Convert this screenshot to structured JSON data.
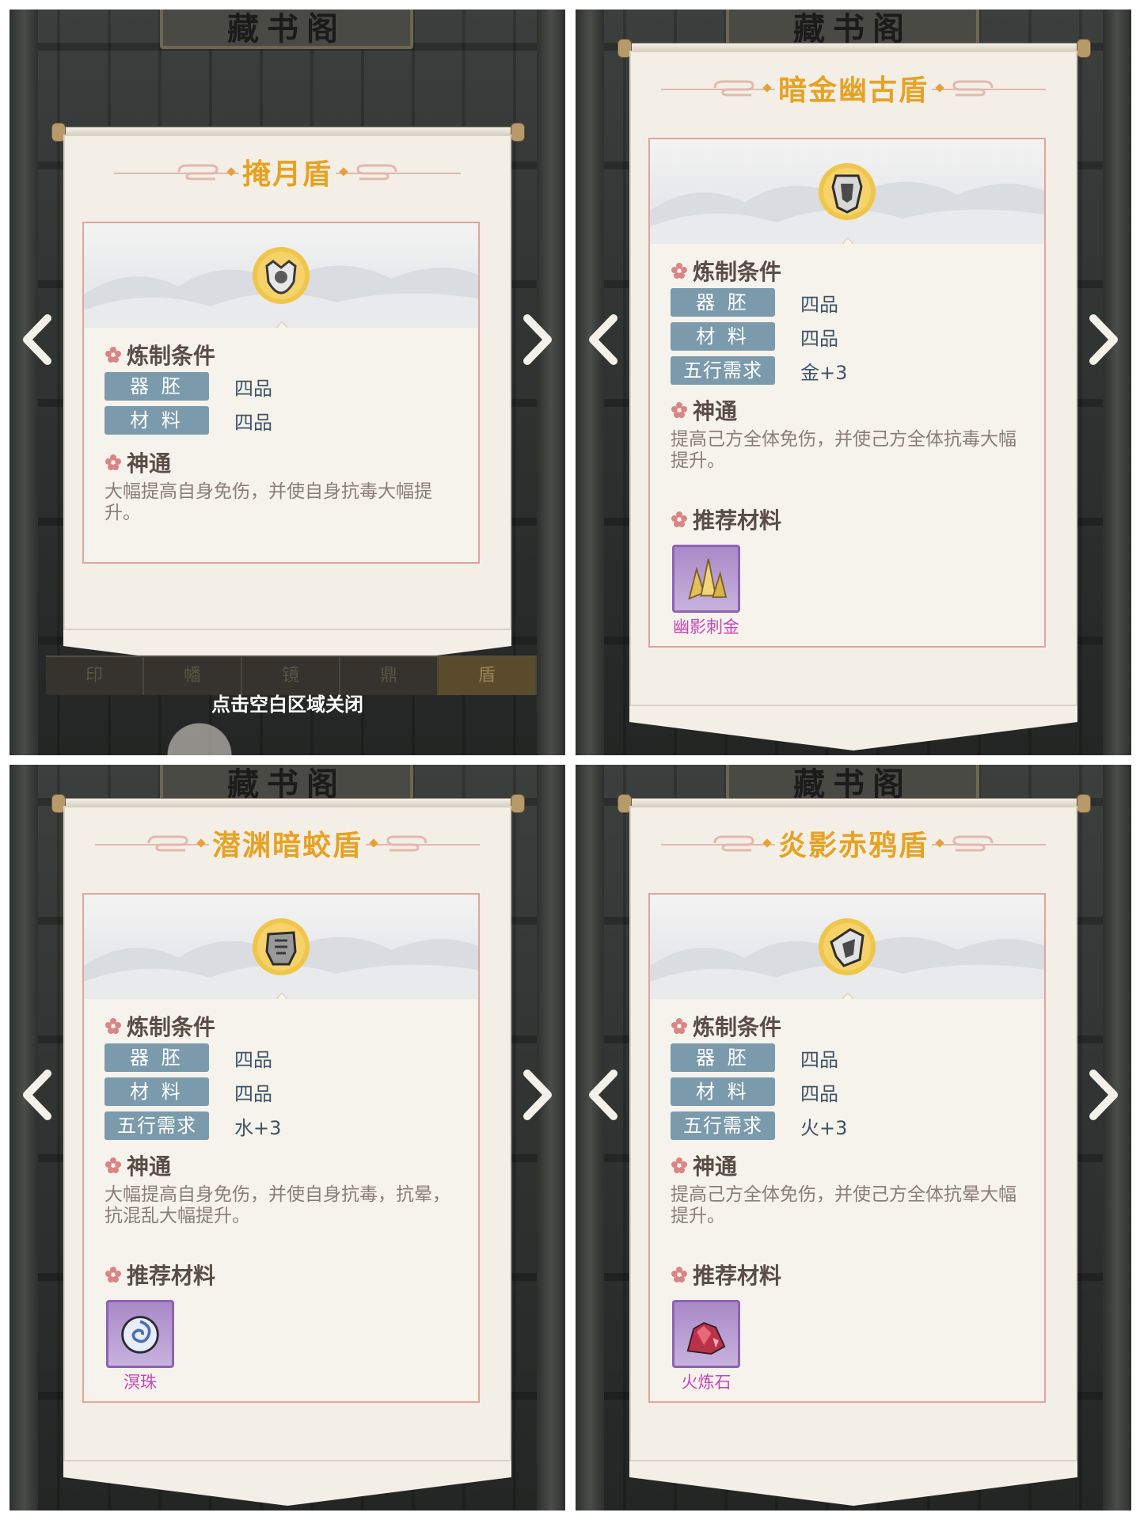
{
  "hall_sign": "藏书阁",
  "close_hint": "点击空白区域关闭",
  "tabs": [
    "印",
    "幡",
    "镜",
    "鼎",
    "盾"
  ],
  "active_tab": "盾",
  "labels": {
    "craft_conditions": "炼制条件",
    "divine_power": "神通",
    "recommended_materials": "推荐材料",
    "vessel": "器 胚",
    "material": "材 料",
    "element_req": "五行需求"
  },
  "colors": {
    "title_gold": "#e7a223",
    "tag_blue": "#7b9bac",
    "material_purple": "#c547b7",
    "frame_pink": "#dfa59d"
  },
  "cards": [
    {
      "name": "掩月盾",
      "icon": "moon-shield-icon",
      "vessel_grade": "四品",
      "material_grade": "四品",
      "element": null,
      "description": "大幅提高自身免伤，并使自身抗毒大幅提升。",
      "material": null
    },
    {
      "name": "暗金幽古盾",
      "icon": "dark-gold-shield-icon",
      "vessel_grade": "四品",
      "material_grade": "四品",
      "element": "金+3",
      "description": "提高己方全体免伤，并使己方全体抗毒大幅提升。",
      "material": {
        "name": "幽影刺金",
        "icon": "gold-crystal-icon"
      }
    },
    {
      "name": "潜渊暗蛟盾",
      "icon": "abyss-dragon-shield-icon",
      "vessel_grade": "四品",
      "material_grade": "四品",
      "element": "水+3",
      "description": "大幅提高自身免伤，并使自身抗毒，抗晕，抗混乱大幅提升。",
      "material": {
        "name": "溟珠",
        "icon": "water-pearl-icon"
      }
    },
    {
      "name": "炎影赤鸦盾",
      "icon": "flame-crow-shield-icon",
      "vessel_grade": "四品",
      "material_grade": "四品",
      "element": "火+3",
      "description": "提高己方全体免伤，并使己方全体抗晕大幅提升。",
      "material": {
        "name": "火炼石",
        "icon": "fire-stone-icon"
      }
    }
  ]
}
